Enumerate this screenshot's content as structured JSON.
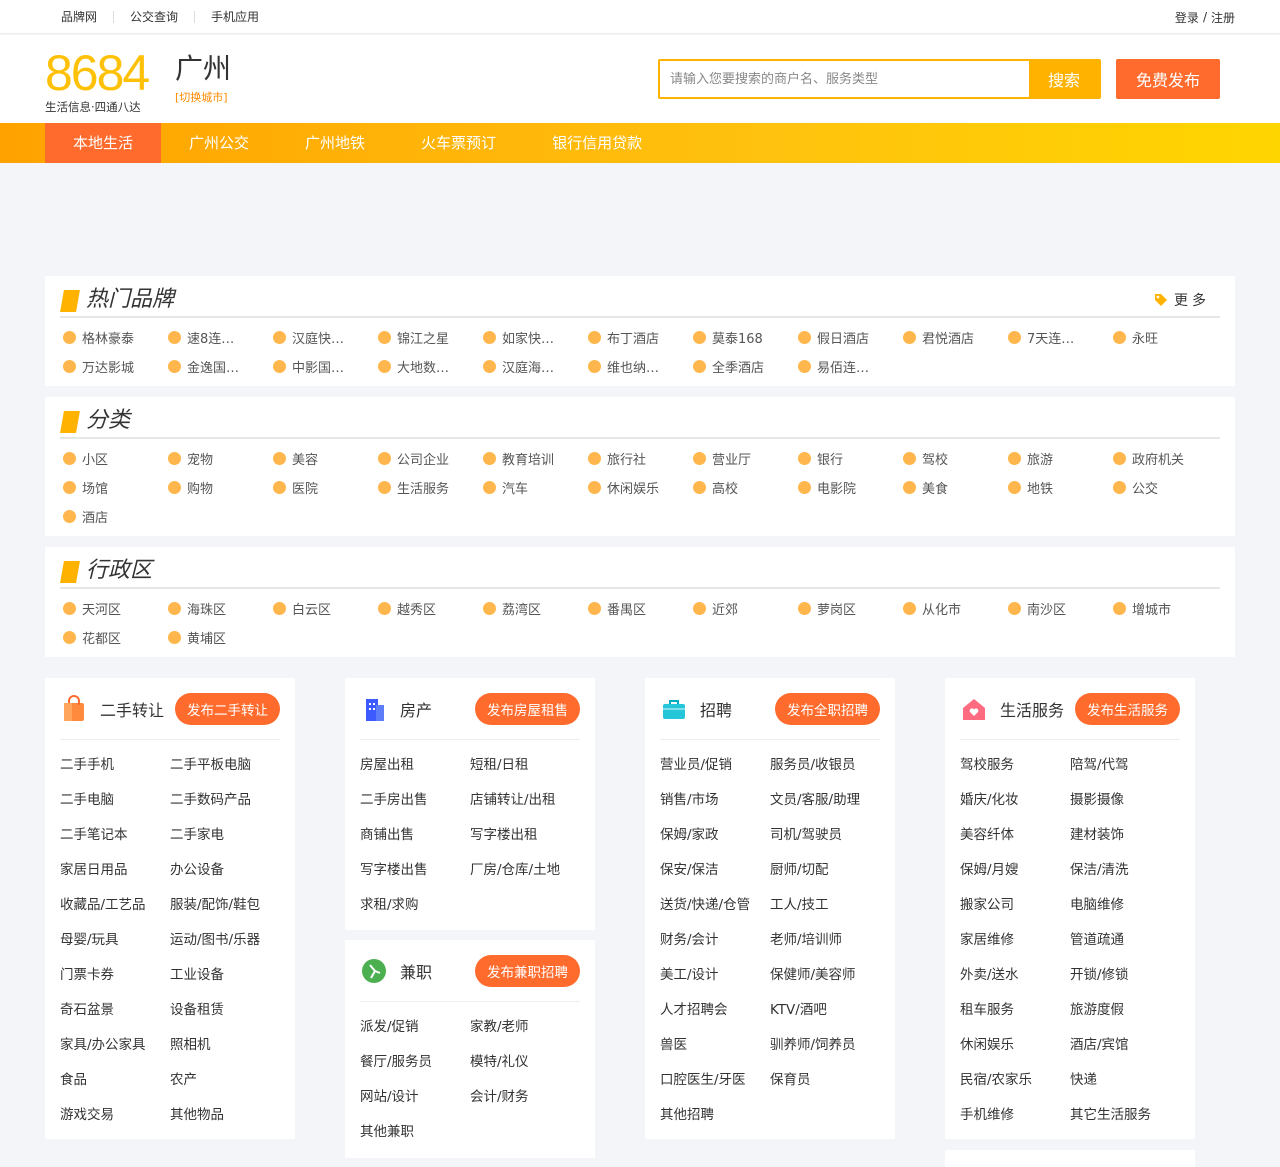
{
  "topbar": {
    "links": [
      "品牌网",
      "公交查询",
      "手机应用"
    ],
    "login": "登录",
    "sep": "/",
    "register": "注册"
  },
  "header": {
    "logo_text": "8684",
    "slogan": "生活信息·四通八达",
    "city": "广州",
    "switch_city": "[切换城市]",
    "search_placeholder": "请输入您要搜索的商户名、服务类型",
    "search_button": "搜索",
    "publish_button": "免费发布"
  },
  "nav": [
    "本地生活",
    "广州公交",
    "广州地铁",
    "火车票预订",
    "银行信用贷款"
  ],
  "brands": {
    "title": "热门品牌",
    "more": "更多",
    "items": [
      "格林豪泰",
      "速8连…",
      "汉庭快…",
      "锦江之星",
      "如家快…",
      "布丁酒店",
      "莫泰168",
      "假日酒店",
      "君悦酒店",
      "7天连…",
      "永旺",
      "万达影城",
      "金逸国…",
      "中影国…",
      "大地数…",
      "汉庭海…",
      "维也纳…",
      "全季酒店",
      "易佰连…"
    ]
  },
  "categories": {
    "title": "分类",
    "items": [
      "小区",
      "宠物",
      "美容",
      "公司企业",
      "教育培训",
      "旅行社",
      "营业厅",
      "银行",
      "驾校",
      "旅游",
      "政府机关",
      "场馆",
      "购物",
      "医院",
      "生活服务",
      "汽车",
      "休闲娱乐",
      "高校",
      "电影院",
      "美食",
      "地铁",
      "公交",
      "酒店"
    ]
  },
  "districts": {
    "title": "行政区",
    "items": [
      "天河区",
      "海珠区",
      "白云区",
      "越秀区",
      "荔湾区",
      "番禺区",
      "近郊",
      "萝岗区",
      "从化市",
      "南沙区",
      "增城市",
      "花都区",
      "黄埔区"
    ]
  },
  "sections": {
    "secondhand": {
      "title": "二手转让",
      "button": "发布二手转让",
      "links": [
        "二手手机",
        "二手平板电脑",
        "二手电脑",
        "二手数码产品",
        "二手笔记本",
        "二手家电",
        "家居日用品",
        "办公设备",
        "收藏品/工艺品",
        "服装/配饰/鞋包",
        "母婴/玩具",
        "运动/图书/乐器",
        "门票卡券",
        "工业设备",
        "奇石盆景",
        "设备租赁",
        "家具/办公家具",
        "照相机",
        "食品",
        "农产",
        "游戏交易",
        "其他物品"
      ]
    },
    "realestate": {
      "title": "房产",
      "button": "发布房屋租售",
      "links": [
        "房屋出租",
        "短租/日租",
        "二手房出售",
        "店铺转让/出租",
        "商铺出售",
        "写字楼出租",
        "写字楼出售",
        "厂房/仓库/土地",
        "求租/求购"
      ]
    },
    "parttime": {
      "title": "兼职",
      "button": "发布兼职招聘",
      "links": [
        "派发/促销",
        "家教/老师",
        "餐厅/服务员",
        "模特/礼仪",
        "网站/设计",
        "会计/财务",
        "其他兼职"
      ]
    },
    "jobs": {
      "title": "招聘",
      "button": "发布全职招聘",
      "links": [
        "营业员/促销",
        "服务员/收银员",
        "销售/市场",
        "文员/客服/助理",
        "保姆/家政",
        "司机/驾驶员",
        "保安/保洁",
        "厨师/切配",
        "送货/快递/仓管",
        "工人/技工",
        "财务/会计",
        "老师/培训师",
        "美工/设计",
        "保健师/美容师",
        "人才招聘会",
        "KTV/酒吧",
        "兽医",
        "驯养师/饲养员",
        "口腔医生/牙医",
        "保育员",
        "其他招聘"
      ]
    },
    "services": {
      "title": "生活服务",
      "button": "发布生活服务",
      "links": [
        "驾校服务",
        "陪驾/代驾",
        "婚庆/化妆",
        "摄影摄像",
        "美容纤体",
        "建材装饰",
        "保姆/月嫂",
        "保洁/清洗",
        "搬家公司",
        "电脑维修",
        "家居维修",
        "管道疏通",
        "外卖/送水",
        "开锁/修锁",
        "租车服务",
        "旅游度假",
        "休闲娱乐",
        "酒店/宾馆",
        "民宿/农家乐",
        "快递",
        "手机维修",
        "其它生活服务"
      ]
    }
  },
  "colors": {
    "accent": "#ffb300",
    "orange": "#ff6b2c",
    "dot": "#ffb74d"
  }
}
